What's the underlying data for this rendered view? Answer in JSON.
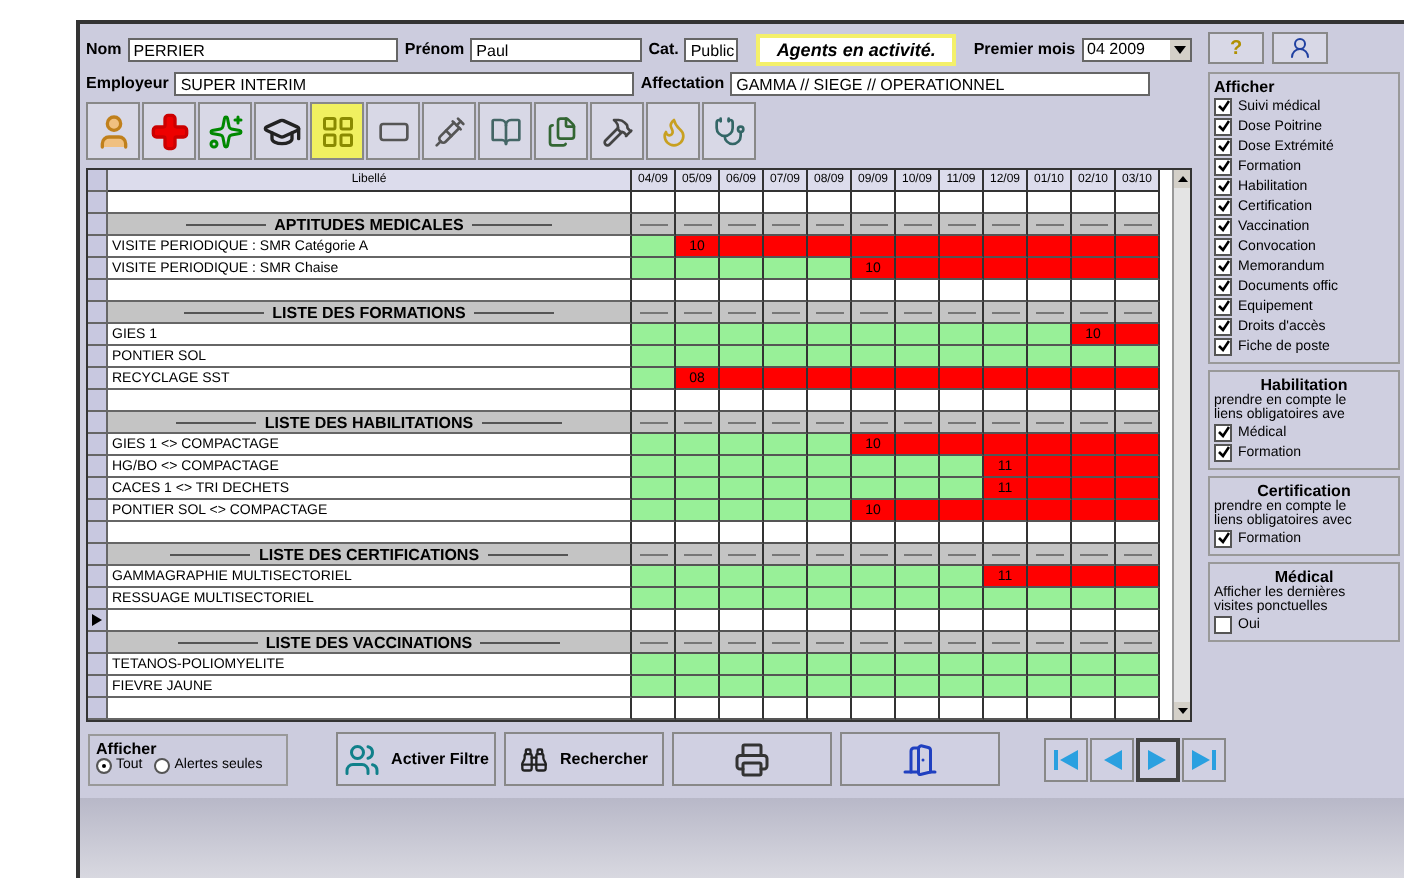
{
  "header": {
    "nom_label": "Nom",
    "nom": "PERRIER",
    "prenom_label": "Prénom",
    "prenom": "Paul",
    "cat_label": "Cat.",
    "cat": "Public",
    "status_banner": "Agents en activité.",
    "premier_mois_label": "Premier mois",
    "premier_mois": "04 2009",
    "employeur_label": "Employeur",
    "employeur": "SUPER INTERIM",
    "affectation_label": "Affectation",
    "affectation": "GAMMA // SIEGE // OPERATIONNEL",
    "help_button": "?"
  },
  "toolbar": [
    {
      "selected": false
    },
    {
      "selected": false
    },
    {
      "selected": false
    },
    {
      "selected": false
    },
    {
      "selected": true
    },
    {
      "selected": false
    },
    {
      "selected": false
    },
    {
      "selected": false
    },
    {
      "selected": false
    },
    {
      "selected": false
    },
    {
      "selected": false
    },
    {
      "selected": false
    }
  ],
  "grid": {
    "label_header": "Libellé",
    "months": [
      "04/09",
      "05/09",
      "06/09",
      "07/09",
      "08/09",
      "09/09",
      "10/09",
      "11/09",
      "12/09",
      "01/10",
      "02/10",
      "03/10"
    ],
    "rows": [
      {
        "kind": "blank",
        "current": false
      },
      {
        "kind": "section",
        "label": "APTITUDES MEDICALES",
        "current": false
      },
      {
        "kind": "item",
        "label": "VISITE PERIODIQUE : SMR Catégorie A",
        "alerts": [
          false,
          true,
          true,
          true,
          true,
          true,
          true,
          true,
          true,
          true,
          true,
          true
        ],
        "alert_text": "10",
        "current": false
      },
      {
        "kind": "item",
        "label": "VISITE PERIODIQUE : SMR Chaise",
        "alerts": [
          false,
          false,
          false,
          false,
          false,
          true,
          true,
          true,
          true,
          true,
          true,
          true
        ],
        "alert_text": "10",
        "current": false
      },
      {
        "kind": "blank",
        "current": false
      },
      {
        "kind": "section",
        "label": "LISTE DES FORMATIONS",
        "current": false
      },
      {
        "kind": "item",
        "label": "GIES 1",
        "alerts": [
          false,
          false,
          false,
          false,
          false,
          false,
          false,
          false,
          false,
          false,
          true,
          true
        ],
        "alert_text": "10",
        "current": false
      },
      {
        "kind": "item",
        "label": "PONTIER SOL",
        "alerts": [
          false,
          false,
          false,
          false,
          false,
          false,
          false,
          false,
          false,
          false,
          false,
          false
        ],
        "current": false
      },
      {
        "kind": "item",
        "label": "RECYCLAGE SST",
        "alerts": [
          false,
          true,
          true,
          true,
          true,
          true,
          true,
          true,
          true,
          true,
          true,
          true
        ],
        "alert_text": "08",
        "current": false
      },
      {
        "kind": "blank",
        "current": false
      },
      {
        "kind": "section",
        "label": "LISTE DES HABILITATIONS",
        "current": false
      },
      {
        "kind": "item",
        "label": "GIES 1 <> COMPACTAGE",
        "alerts": [
          false,
          false,
          false,
          false,
          false,
          true,
          true,
          true,
          true,
          true,
          true,
          true
        ],
        "alert_text": "10",
        "current": false
      },
      {
        "kind": "item",
        "label": "HG/BO <> COMPACTAGE",
        "alerts": [
          false,
          false,
          false,
          false,
          false,
          false,
          false,
          false,
          true,
          true,
          true,
          true
        ],
        "alert_text": "11",
        "current": false
      },
      {
        "kind": "item",
        "label": "CACES 1 <> TRI DECHETS",
        "alerts": [
          false,
          false,
          false,
          false,
          false,
          false,
          false,
          false,
          true,
          true,
          true,
          true
        ],
        "alert_text": "11",
        "current": false
      },
      {
        "kind": "item",
        "label": "PONTIER SOL <> COMPACTAGE",
        "alerts": [
          false,
          false,
          false,
          false,
          false,
          true,
          true,
          true,
          true,
          true,
          true,
          true
        ],
        "alert_text": "10",
        "current": false
      },
      {
        "kind": "blank",
        "current": false
      },
      {
        "kind": "section",
        "label": "LISTE DES CERTIFICATIONS",
        "current": false
      },
      {
        "kind": "item",
        "label": "GAMMAGRAPHIE MULTISECTORIEL",
        "alerts": [
          false,
          false,
          false,
          false,
          false,
          false,
          false,
          false,
          true,
          true,
          true,
          true
        ],
        "alert_text": "11",
        "current": false
      },
      {
        "kind": "item",
        "label": "RESSUAGE MULTISECTORIEL",
        "alerts": [
          false,
          false,
          false,
          false,
          false,
          false,
          false,
          false,
          false,
          false,
          false,
          false
        ],
        "current": false
      },
      {
        "kind": "blank",
        "current": true
      },
      {
        "kind": "section",
        "label": "LISTE DES VACCINATIONS",
        "current": false
      },
      {
        "kind": "item",
        "label": "TETANOS-POLIOMYELITE",
        "alerts": [
          false,
          false,
          false,
          false,
          false,
          false,
          false,
          false,
          false,
          false,
          false,
          false
        ],
        "current": false
      },
      {
        "kind": "item",
        "label": "FIEVRE JAUNE",
        "alerts": [
          false,
          false,
          false,
          false,
          false,
          false,
          false,
          false,
          false,
          false,
          false,
          false
        ],
        "current": false
      },
      {
        "kind": "blank",
        "current": false
      }
    ]
  },
  "side": {
    "afficher": {
      "title": "Afficher",
      "options": [
        {
          "label": "Suivi médical",
          "checked": true
        },
        {
          "label": "Dose Poitrine",
          "checked": true
        },
        {
          "label": "Dose Extrémité",
          "checked": true
        },
        {
          "label": "Formation",
          "checked": true
        },
        {
          "label": "Habilitation",
          "checked": true
        },
        {
          "label": "Certification",
          "checked": true
        },
        {
          "label": "Vaccination",
          "checked": true
        },
        {
          "label": "Convocation",
          "checked": true
        },
        {
          "label": "Memorandum",
          "checked": true
        },
        {
          "label": "Documents offic",
          "checked": true
        },
        {
          "label": "Equipement",
          "checked": true
        },
        {
          "label": "Droits d'accès",
          "checked": true
        },
        {
          "label": "Fiche de poste",
          "checked": true
        }
      ]
    },
    "groups": [
      {
        "title": "Habilitation",
        "note": [
          "prendre en compte le",
          "liens obligatoires ave"
        ],
        "options": [
          {
            "label": "Médical",
            "checked": true
          },
          {
            "label": "Formation",
            "checked": true
          }
        ]
      },
      {
        "title": "Certification",
        "note": [
          "prendre en compte le",
          "liens obligatoires avec"
        ],
        "options": [
          {
            "label": "Formation",
            "checked": true
          }
        ]
      },
      {
        "title": "Médical",
        "note": [
          "Afficher les dernières",
          "visites ponctuelles"
        ],
        "options": [
          {
            "label": "Oui",
            "checked": false
          }
        ]
      }
    ]
  },
  "bottom": {
    "filter": {
      "title": "Afficher",
      "options": [
        {
          "label": "Tout",
          "selected": true
        },
        {
          "label": "Alertes seules",
          "selected": false
        }
      ]
    },
    "buttons": [
      {
        "kind": "filter",
        "label": "Activer Filtre"
      },
      {
        "kind": "search",
        "label": "Rechercher"
      },
      {
        "kind": "print"
      },
      {
        "kind": "exit"
      }
    ],
    "nav": [
      {
        "kind": "first",
        "selected": false
      },
      {
        "kind": "prev",
        "selected": false
      },
      {
        "kind": "next",
        "selected": true
      },
      {
        "kind": "last",
        "selected": false
      }
    ]
  }
}
